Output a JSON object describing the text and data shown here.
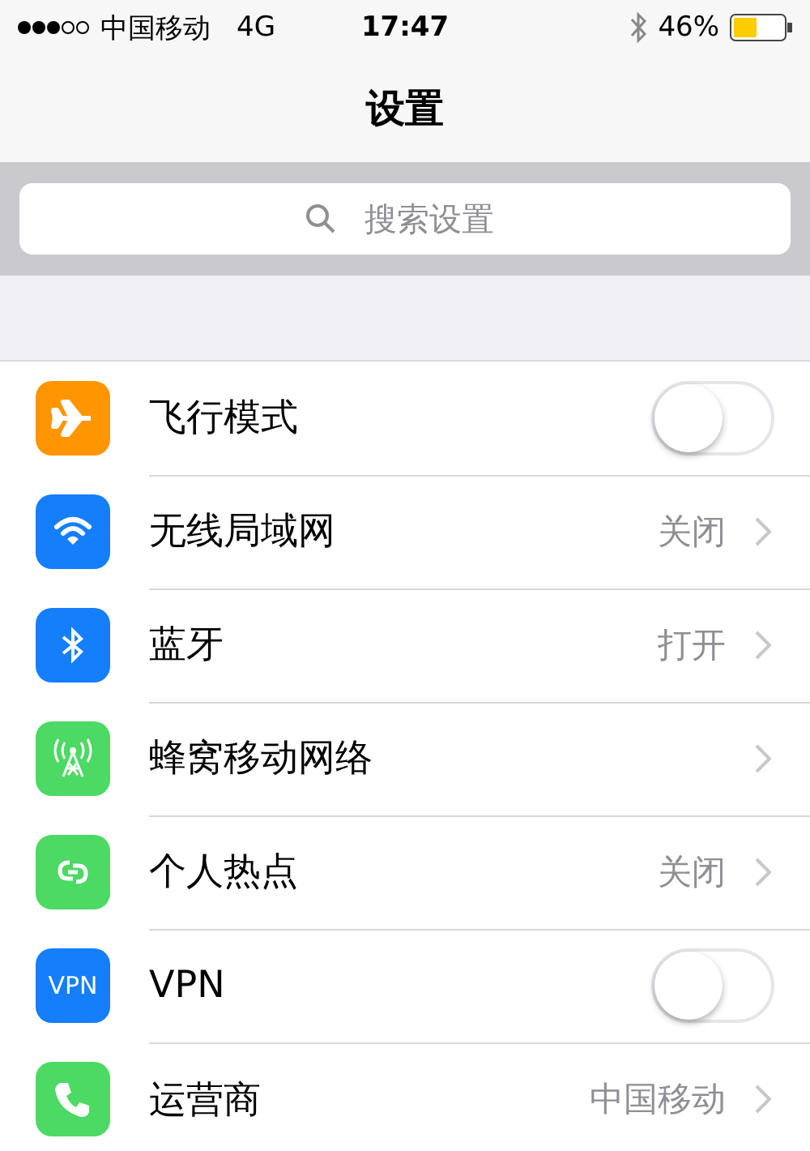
{
  "status_bar": {
    "carrier": "中国移动",
    "network": "4G",
    "time": "17:47",
    "battery": "46%"
  },
  "title": "设置",
  "search": {
    "placeholder": "搜索设置"
  },
  "rows": [
    {
      "color": "#ff9500",
      "label": "飞行模式",
      "kind": "toggle",
      "on": false
    },
    {
      "color": "#147efb",
      "label": "无线局域网",
      "kind": "link",
      "value": "关闭"
    },
    {
      "color": "#147efb",
      "label": "蓝牙",
      "kind": "link",
      "value": "打开"
    },
    {
      "color": "#4cd964",
      "label": "蜂窝移动网络",
      "kind": "link"
    },
    {
      "color": "#4cd964",
      "label": "个人热点",
      "kind": "link",
      "value": "关闭"
    },
    {
      "color": "#147efb",
      "icon_text": "VPN",
      "label": "VPN",
      "kind": "toggle",
      "on": false
    },
    {
      "color": "#4cd964",
      "label": "运营商",
      "kind": "link",
      "value": "中国移动"
    }
  ]
}
